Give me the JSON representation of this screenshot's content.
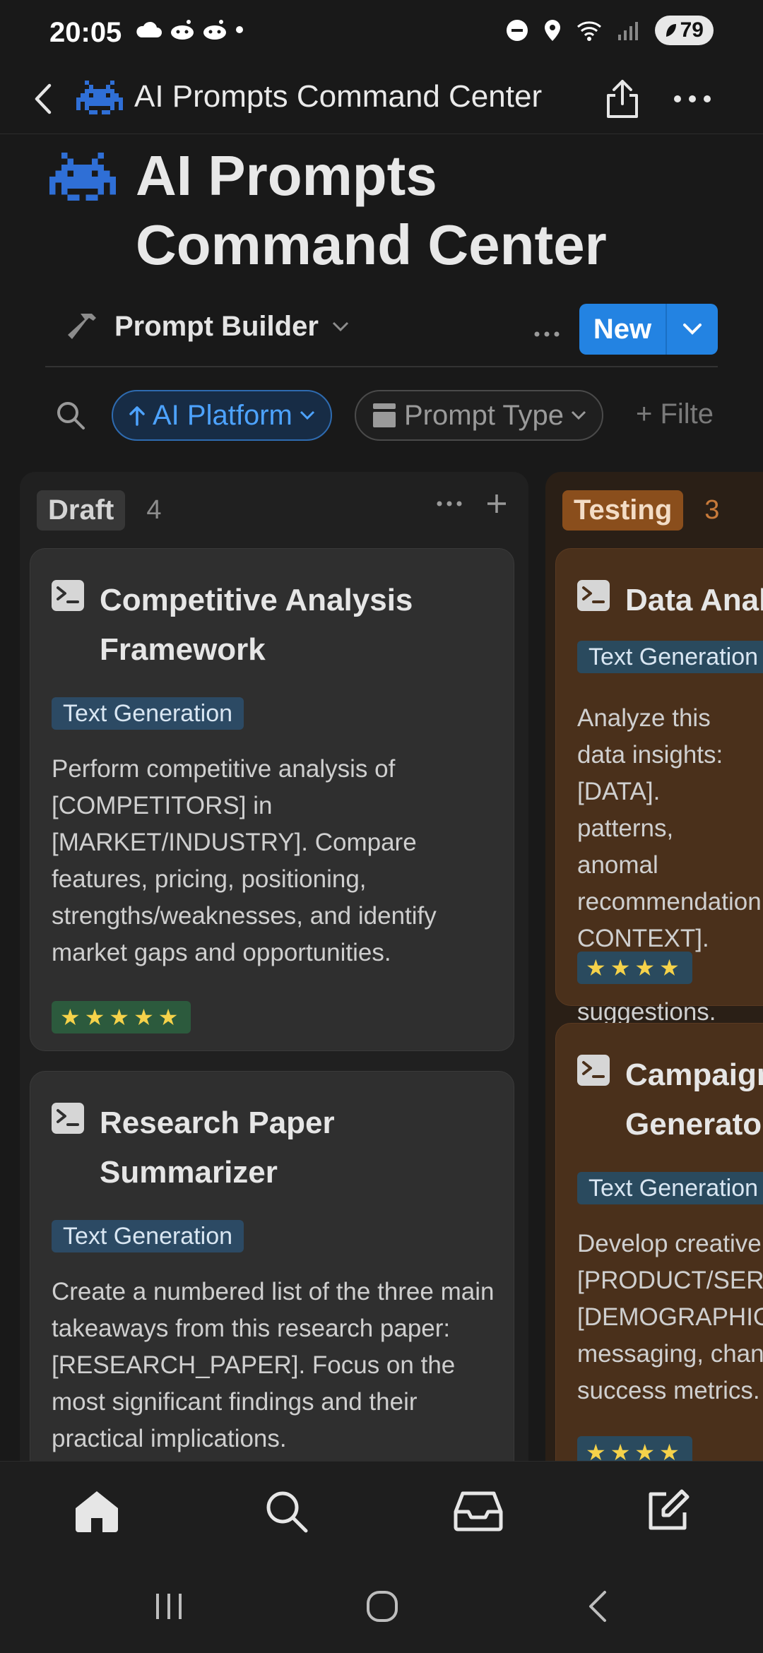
{
  "status_bar": {
    "time": "20:05",
    "battery": "79"
  },
  "top_bar": {
    "title": "AI Prompts Command Center"
  },
  "page": {
    "title": "AI Prompts Command Center"
  },
  "view": {
    "name": "Prompt Builder",
    "new_label": "New"
  },
  "filters": {
    "platform_chip": "AI Platform",
    "type_chip": "Prompt Type",
    "add_filter": "+ Filte"
  },
  "columns": [
    {
      "status": "Draft",
      "count": "4",
      "cards": [
        {
          "title": "Competitive Analysis Framework",
          "tag": "Text Generation",
          "description": "Perform competitive analysis of [COMPETITORS] in [MARKET/INDUSTRY]. Compare features, pricing, positioning, strengths/weaknesses, and identify market gaps and opportunities.",
          "rating": "★★★★★"
        },
        {
          "title": "Research Paper Summarizer",
          "tag": "Text Generation",
          "description": "Create a numbered list of the three main takeaways from this research paper: [RESEARCH_PAPER]. Focus on the most significant findings and their practical implications."
        }
      ]
    },
    {
      "status": "Testing",
      "count": "3",
      "cards": [
        {
          "title": "Data Anal",
          "tag": "Text Generation",
          "description": "Analyze this data insights: [DATA]. patterns, anomal recommendation CONTEXT]. Incluc suggestions.",
          "rating": "★★★★"
        },
        {
          "title": "Campaign Generator",
          "tag": "Text Generation",
          "description": "Develop creative [PRODUCT/SERV [DEMOGRAPHIC] messaging, chan success metrics.",
          "rating": "★★★★"
        }
      ]
    }
  ]
}
